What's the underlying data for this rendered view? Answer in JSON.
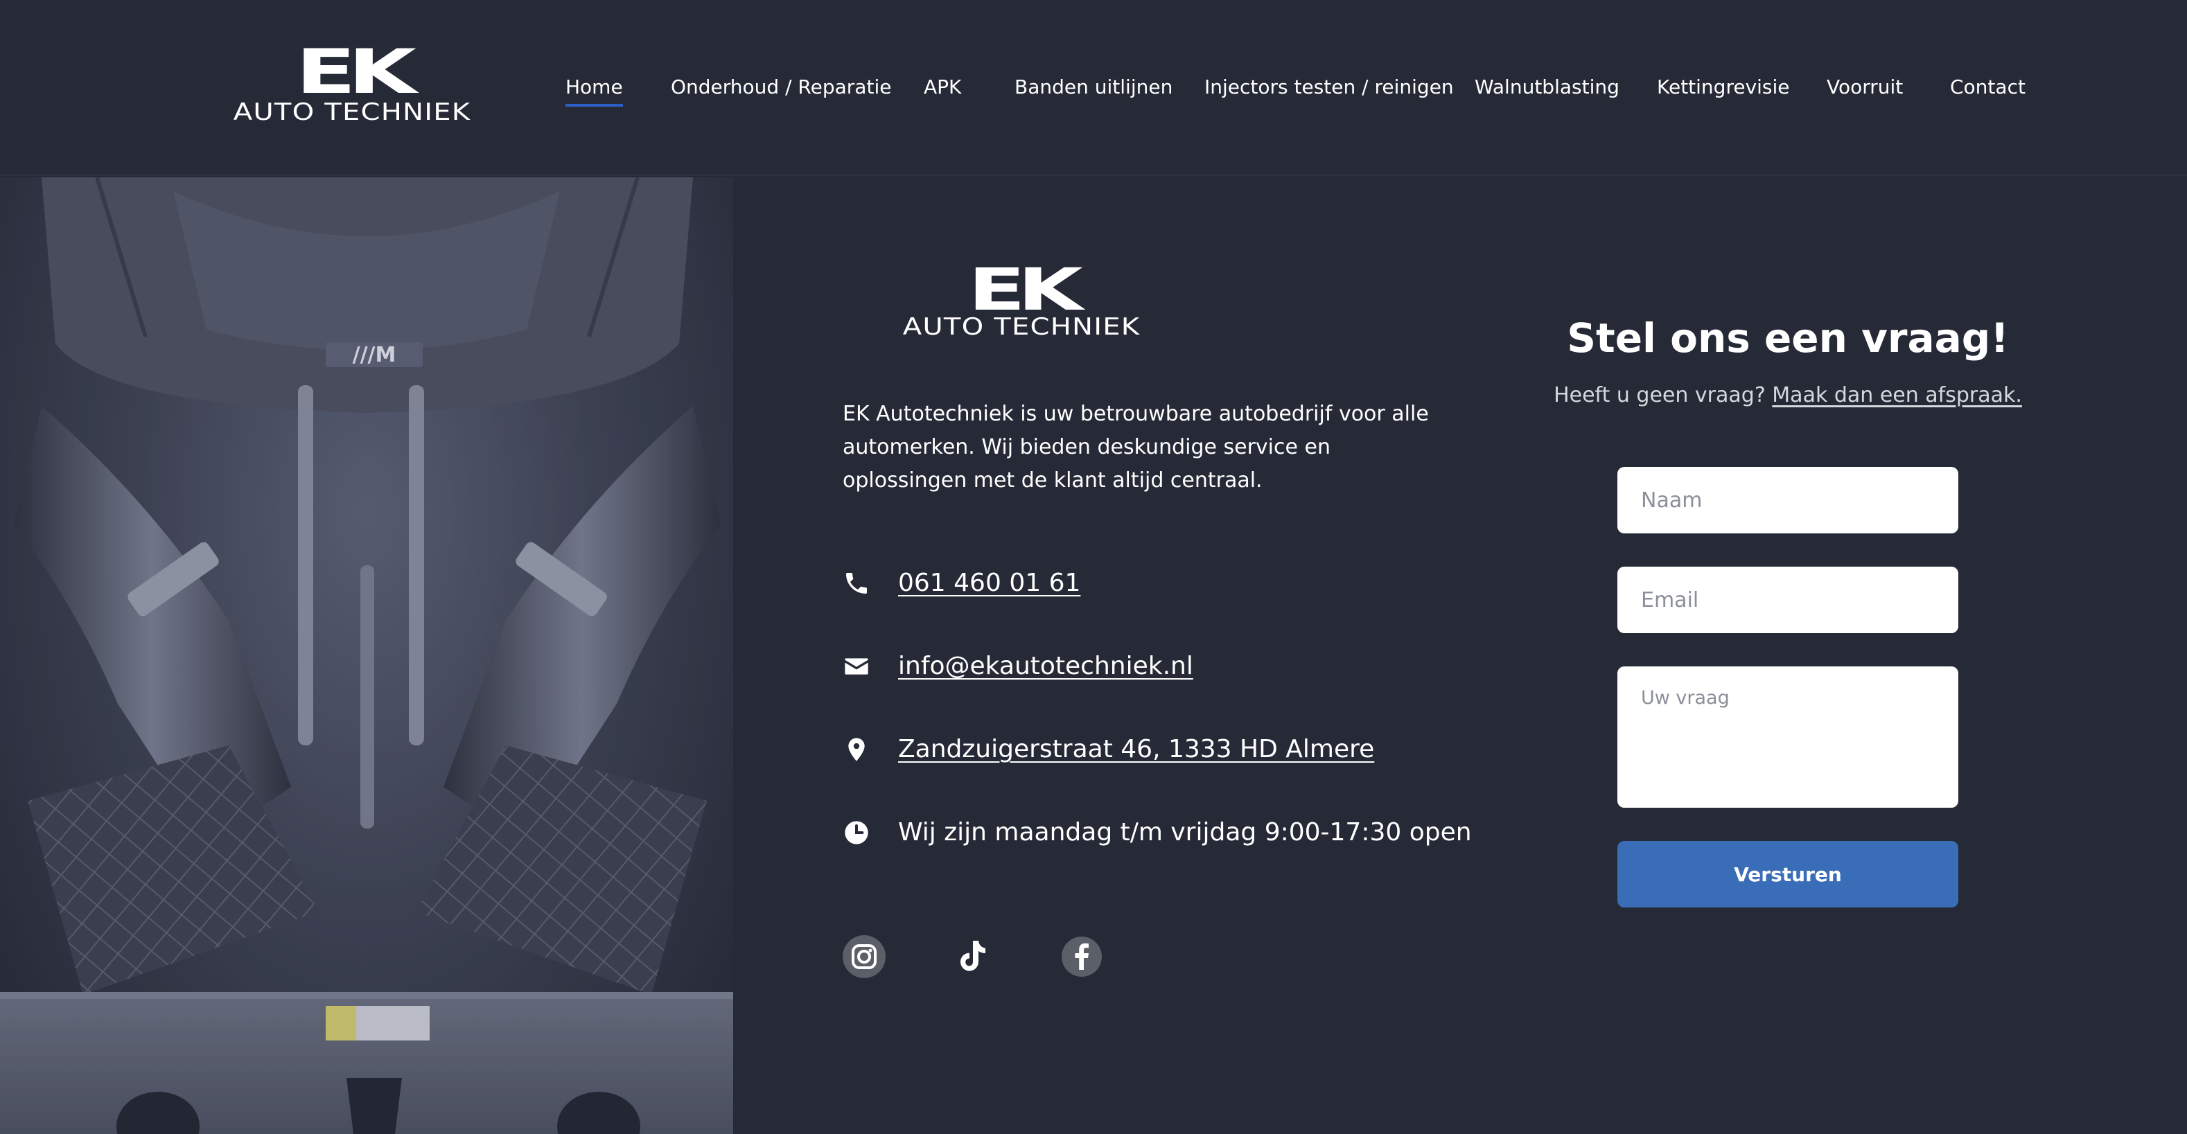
{
  "brand": {
    "logo_big": "EK",
    "logo_small": "AUTO TECHNIEK"
  },
  "nav": {
    "items": [
      {
        "label": "Home",
        "active": true
      },
      {
        "label": "Onderhoud / Reparatie"
      },
      {
        "label": "APK"
      },
      {
        "label": "Banden uitlijnen"
      },
      {
        "label": "Injectors testen / reinigen"
      },
      {
        "label": "Walnutblasting"
      },
      {
        "label": "Kettingrevisie"
      },
      {
        "label": "Voorruit"
      },
      {
        "label": "Contact"
      }
    ]
  },
  "about": {
    "text": "EK Autotechniek is uw betrouwbare autobedrijf voor alle automerken. Wij bieden deskundige service en oplossingen met de klant altijd centraal.",
    "phone": "061 460 01 61",
    "email": "info@ekautotechniek.nl",
    "address": "Zandzuigerstraat 46, 1333 HD Almere",
    "hours": "Wij zijn maandag t/m vrijdag 9:00-17:30 open",
    "icons": {
      "phone": "phone-icon",
      "email": "envelope-icon",
      "address": "map-pin-icon",
      "hours": "clock-icon"
    }
  },
  "social": [
    "instagram-icon",
    "tiktok-icon",
    "facebook-icon"
  ],
  "form": {
    "title": "Stel ons een vraag!",
    "subtitle_prefix": "Heeft u geen vraag?",
    "subtitle_link": "Maak dan een afspraak.",
    "name_placeholder": "Naam",
    "email_placeholder": "Email",
    "question_placeholder": "Uw vraag",
    "submit_label": "Versturen"
  },
  "colors": {
    "background": "#262a37",
    "accent": "#3a6db8",
    "nav_active": "#2f5fc4"
  }
}
